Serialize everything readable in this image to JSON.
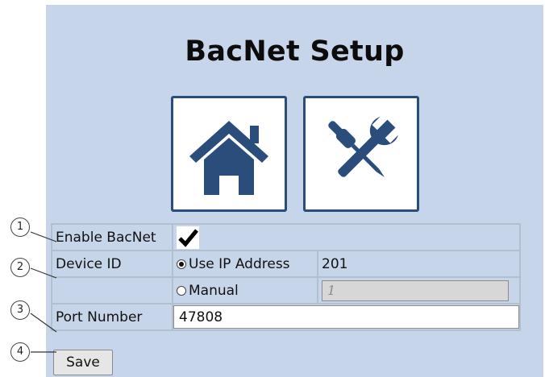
{
  "page": {
    "title": "BacNet Setup"
  },
  "nav": {
    "home": {
      "icon": "home-icon"
    },
    "tools": {
      "icon": "wrench-screwdriver-icon"
    }
  },
  "form": {
    "enable": {
      "label": "Enable BacNet",
      "checked": true
    },
    "device_id": {
      "label": "Device ID",
      "option_ip": "Use IP Address",
      "ip_value": "201",
      "option_manual": "Manual",
      "manual_value": "1",
      "selected": "Use IP Address"
    },
    "port": {
      "label": "Port Number",
      "value": "47808"
    },
    "save_label": "Save"
  },
  "callouts": [
    "1",
    "2",
    "3",
    "4"
  ],
  "colors": {
    "panel": "#c6d5e9",
    "icon_blue": "#2a4d7c"
  }
}
